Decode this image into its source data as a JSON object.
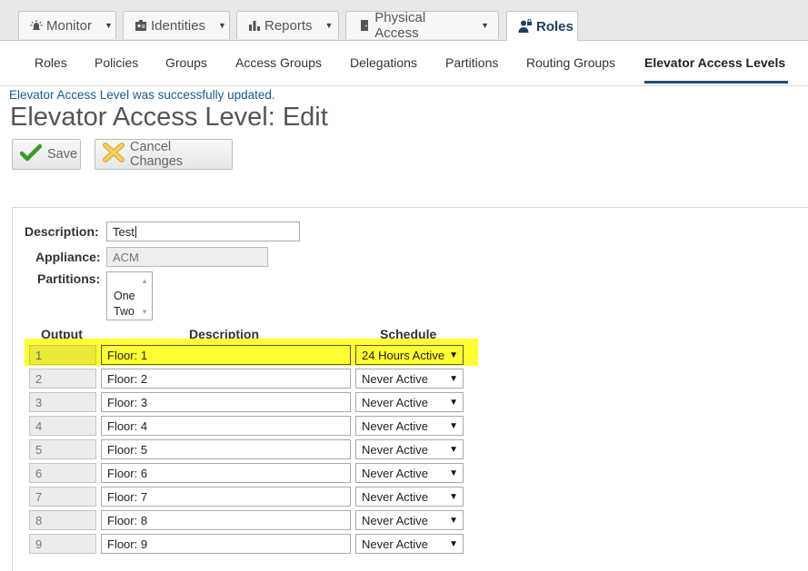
{
  "top_tabs": [
    {
      "label": "Monitor",
      "icon": "alarm-light-icon"
    },
    {
      "label": "Identities",
      "icon": "id-card-icon"
    },
    {
      "label": "Reports",
      "icon": "bar-chart-icon"
    },
    {
      "label": "Physical Access",
      "icon": "door-icon"
    },
    {
      "label": "Roles",
      "icon": "user-lock-icon"
    }
  ],
  "sub_nav": [
    "Roles",
    "Policies",
    "Groups",
    "Access Groups",
    "Delegations",
    "Partitions",
    "Routing Groups",
    "Elevator Access Levels"
  ],
  "flash_message": "Elevator Access Level was successfully updated.",
  "page_title": "Elevator Access Level: Edit",
  "buttons": {
    "save": "Save",
    "cancel": "Cancel Changes"
  },
  "form": {
    "description_label": "Description:",
    "description_value": "Test",
    "appliance_label": "Appliance:",
    "appliance_value": "ACM",
    "partitions_label": "Partitions:",
    "partitions_options": [
      "One",
      "Two"
    ]
  },
  "table": {
    "headers": {
      "output": "Output",
      "description": "Description",
      "schedule": "Schedule"
    },
    "rows": [
      {
        "output": "1",
        "description": "Floor: 1",
        "schedule": "24 Hours Active"
      },
      {
        "output": "2",
        "description": "Floor: 2",
        "schedule": "Never Active"
      },
      {
        "output": "3",
        "description": "Floor: 3",
        "schedule": "Never Active"
      },
      {
        "output": "4",
        "description": "Floor: 4",
        "schedule": "Never Active"
      },
      {
        "output": "5",
        "description": "Floor: 5",
        "schedule": "Never Active"
      },
      {
        "output": "6",
        "description": "Floor: 6",
        "schedule": "Never Active"
      },
      {
        "output": "7",
        "description": "Floor: 7",
        "schedule": "Never Active"
      },
      {
        "output": "8",
        "description": "Floor: 8",
        "schedule": "Never Active"
      },
      {
        "output": "9",
        "description": "Floor: 9",
        "schedule": "Never Active"
      }
    ]
  },
  "colors": {
    "accent": "#1f4e79",
    "highlight": "#ffff33",
    "flash": "#1a5a8c"
  }
}
